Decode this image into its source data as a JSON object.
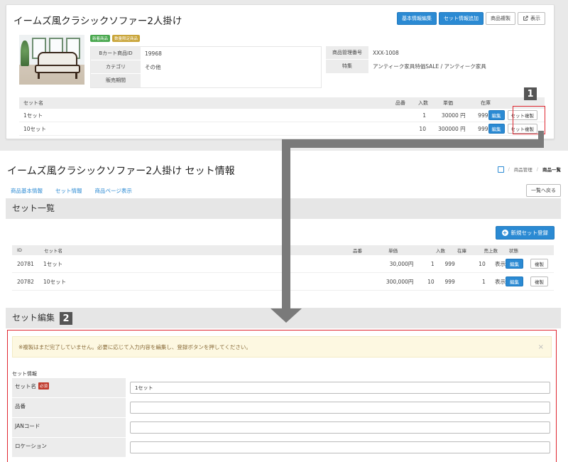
{
  "top": {
    "title": "イームズ風クラシックソファー2人掛け",
    "actions": [
      "基本情報編集",
      "セット情報追加",
      "商品複製",
      "表示"
    ],
    "badges": [
      {
        "label": "新着商品",
        "color": "#4aa84f"
      },
      {
        "label": "数量限定商品",
        "color": "#c9a53a"
      }
    ],
    "info_left": [
      {
        "label": "Bカート商品ID",
        "value": "19968"
      },
      {
        "label": "カテゴリ",
        "value": "その他"
      },
      {
        "label": "販売期間",
        "value": ""
      }
    ],
    "info_right": [
      {
        "label": "商品管理番号",
        "value": "XXX-1008"
      },
      {
        "label": "特集",
        "value": "アンティーク家具特価SALE / アンティーク家具"
      }
    ],
    "set_table": {
      "headers": [
        "セット名",
        "品番",
        "入数",
        "単価",
        "在庫"
      ],
      "rows": [
        {
          "name": "1セット",
          "code": "",
          "qty": "1",
          "price": "30000 円",
          "stock": "999",
          "edit": "編集",
          "copy": "セット複製"
        },
        {
          "name": "10セット",
          "code": "",
          "qty": "10",
          "price": "300000 円",
          "stock": "999",
          "edit": "編集",
          "copy": "セット複製"
        }
      ]
    },
    "callout_number": "1"
  },
  "main": {
    "title": "イームズ風クラシックソファー2人掛け セット情報",
    "breadcrumbs": [
      "商品管理",
      "商品一覧"
    ],
    "subnav": [
      "商品基本情報",
      "セット情報",
      "商品ページ表示"
    ],
    "back_label": "一覧へ戻る",
    "list_section": {
      "heading": "セット一覧",
      "new_button": "新規セット登録",
      "headers": [
        "ID",
        "セット名",
        "品番",
        "単価",
        "入数",
        "在庫",
        "売上数",
        "状態"
      ],
      "rows": [
        {
          "id": "20781",
          "name": "1セット",
          "code": "",
          "price": "30,000円",
          "qty": "1",
          "stock": "999",
          "sold": "10",
          "status": "表示",
          "edit": "編集",
          "copy": "複製"
        },
        {
          "id": "20782",
          "name": "10セット",
          "code": "",
          "price": "300,000円",
          "qty": "10",
          "stock": "999",
          "sold": "1",
          "status": "表示",
          "edit": "編集",
          "copy": "複製"
        }
      ]
    },
    "edit_section": {
      "heading": "セット編集",
      "callout_number": "2",
      "alert": "※複製はまだ完了していません。必要に応じて入力内容を編集し、登録ボタンを押してください。",
      "form_title": "セット情報",
      "required_label": "必須",
      "fields": [
        {
          "label": "セット名",
          "value": "1セット",
          "required": true
        },
        {
          "label": "品番",
          "value": "",
          "required": false
        },
        {
          "label": "JANコード",
          "value": "",
          "required": false
        },
        {
          "label": "ロケーション",
          "value": "",
          "required": false
        }
      ]
    }
  }
}
